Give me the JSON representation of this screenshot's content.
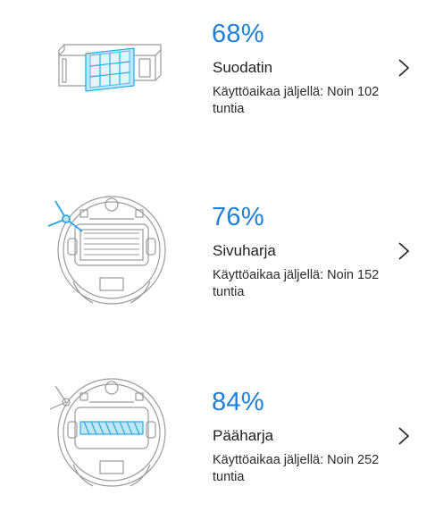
{
  "accent_color": "#1f7fd8",
  "items": [
    {
      "percent": "68%",
      "name": "Suodatin",
      "remaining": "Käyttöaikaa jäljellä: Noin 102 tuntia",
      "icon": "filter-icon"
    },
    {
      "percent": "76%",
      "name": "Sivuharja",
      "remaining": "Käyttöaikaa jäljellä: Noin 152 tuntia",
      "icon": "side-brush-icon"
    },
    {
      "percent": "84%",
      "name": "Pääharja",
      "remaining": "Käyttöaikaa jäljellä: Noin 252 tuntia",
      "icon": "main-brush-icon"
    }
  ]
}
